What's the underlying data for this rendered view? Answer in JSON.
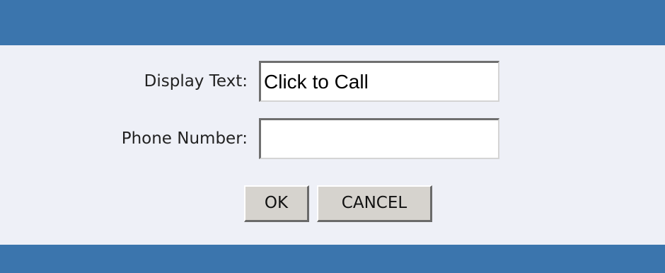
{
  "form": {
    "display_text": {
      "label": "Display Text:",
      "value": "Click to Call"
    },
    "phone_number": {
      "label": "Phone Number:",
      "value": ""
    }
  },
  "buttons": {
    "ok_label": "OK",
    "cancel_label": "CANCEL"
  },
  "colors": {
    "header_bar": "#3b75ad",
    "dialog_background": "#eef0f7",
    "button_face": "#d6d3ce"
  }
}
